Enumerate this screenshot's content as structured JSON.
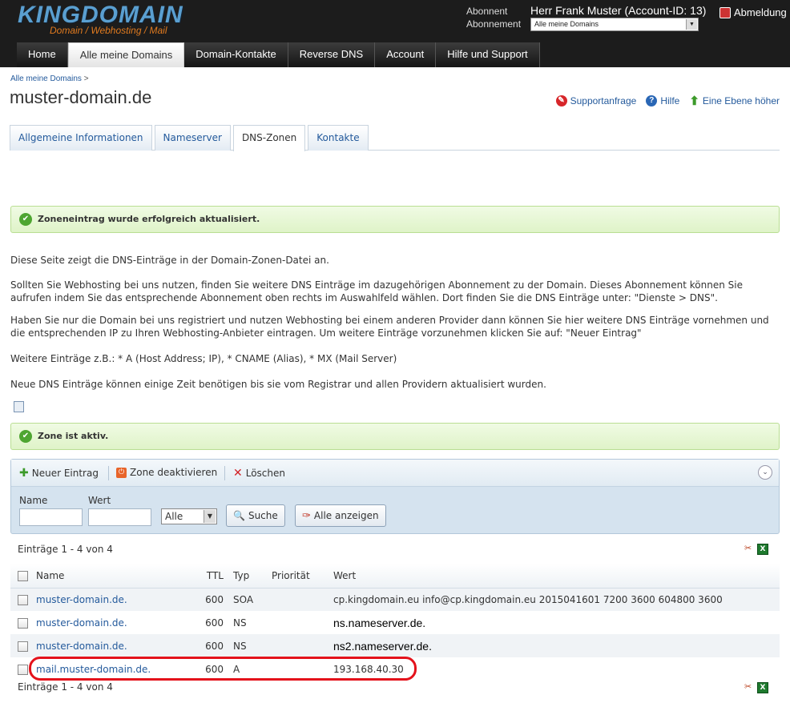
{
  "header": {
    "logo_text": "KINGDOMAIN",
    "logo_tagline": "Domain / Webhosting / Mail",
    "subscriber_label_1": "Abonnent",
    "subscriber_label_2": "Abonnement",
    "user": "Herr Frank Muster (Account-ID: 13)",
    "subscription_select": "Alle meine Domains",
    "logout": "Abmeldung"
  },
  "nav": {
    "items": [
      "Home",
      "Alle meine Domains",
      "Domain-Kontakte",
      "Reverse DNS",
      "Account",
      "Hilfe und Support"
    ],
    "active": "Alle meine Domains"
  },
  "breadcrumb": {
    "link": "Alle meine Domains",
    "sep": ">"
  },
  "page_title": "muster-domain.de",
  "top_actions": {
    "support": "Supportanfrage",
    "help": "Hilfe",
    "up": "Eine Ebene höher"
  },
  "tabs": [
    "Allgemeine Informationen",
    "Nameserver",
    "DNS-Zonen",
    "Kontakte"
  ],
  "messages": {
    "updated": "Zoneneintrag wurde erfolgreich aktualisiert.",
    "active": "Zone ist aktiv."
  },
  "info": {
    "p1": "Diese Seite zeigt die DNS-Einträge in der Domain-Zonen-Datei an.",
    "p2": "Sollten Sie Webhosting bei uns nutzen, finden Sie weitere DNS Einträge im dazugehörigen Abonnement zu der Domain. Dieses Abonnement können Sie aufrufen indem Sie das entsprechende Abonnement oben rechts im Auswahlfeld wählen. Dort finden Sie die DNS Einträge unter: \"Dienste > DNS\".",
    "p3": "Haben Sie nur die Domain bei uns registriert und nutzen Webhosting bei einem anderen Provider dann können Sie hier weitere DNS Einträge vornehmen und die entsprechenden IP zu Ihren Webhosting-Anbieter eintragen. Um weitere Einträge vorzunehmen klicken Sie auf: \"Neuer Eintrag\"",
    "p4": "Weitere Einträge z.B.: * A (Host Address; IP), * CNAME (Alias), * MX (Mail Server)",
    "p5": "Neue DNS Einträge können einige Zeit benötigen bis sie vom Registrar und allen Providern aktualisiert wurden."
  },
  "toolbar": {
    "new": "Neuer Eintrag",
    "deactivate": "Zone deaktivieren",
    "delete": "Löschen"
  },
  "filter": {
    "name_label": "Name",
    "value_label": "Wert",
    "type_select": "Alle",
    "search_button": "Suche",
    "show_all_button": "Alle anzeigen"
  },
  "entries_count": "Einträge 1 - 4 von 4",
  "table": {
    "headers": {
      "name": "Name",
      "ttl": "TTL",
      "type": "Typ",
      "priority": "Priorität",
      "value": "Wert"
    },
    "rows": [
      {
        "name": "muster-domain.de.",
        "ttl": "600",
        "type": "SOA",
        "priority": "",
        "value": "cp.kingdomain.eu info@cp.kingdomain.eu 2015041601 7200 3600 604800 3600"
      },
      {
        "name": "muster-domain.de.",
        "ttl": "600",
        "type": "NS",
        "priority": "",
        "value": "ns.nameserver.de."
      },
      {
        "name": "muster-domain.de.",
        "ttl": "600",
        "type": "NS",
        "priority": "",
        "value": "ns2.nameserver.de."
      },
      {
        "name": "mail.muster-domain.de.",
        "ttl": "600",
        "type": "A",
        "priority": "",
        "value": "193.168.40.30"
      }
    ]
  },
  "colors": {
    "accent": "#245a9c",
    "success": "#4ea531",
    "highlight": "#e4121b"
  }
}
